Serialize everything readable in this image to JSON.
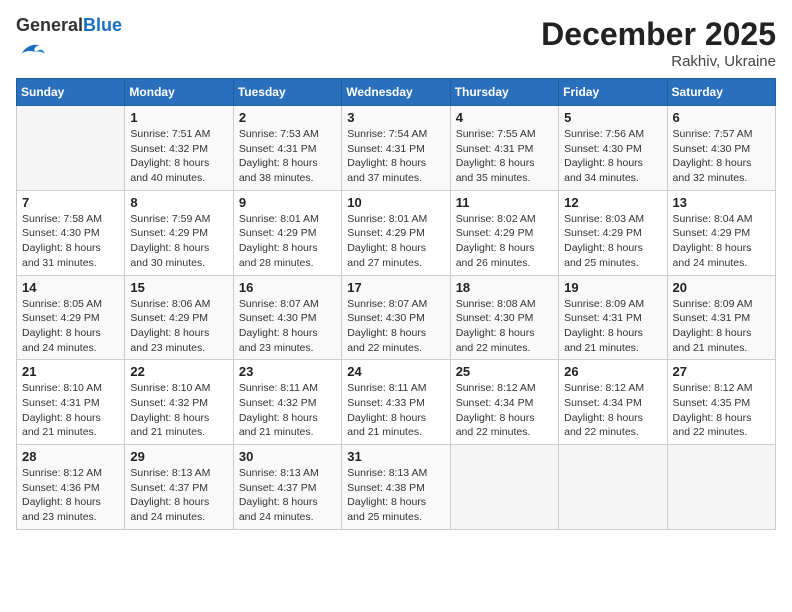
{
  "header": {
    "logo_general": "General",
    "logo_blue": "Blue",
    "month_title": "December 2025",
    "subtitle": "Rakhiv, Ukraine"
  },
  "weekdays": [
    "Sunday",
    "Monday",
    "Tuesday",
    "Wednesday",
    "Thursday",
    "Friday",
    "Saturday"
  ],
  "weeks": [
    [
      {
        "day": "",
        "info": ""
      },
      {
        "day": "1",
        "info": "Sunrise: 7:51 AM\nSunset: 4:32 PM\nDaylight: 8 hours\nand 40 minutes."
      },
      {
        "day": "2",
        "info": "Sunrise: 7:53 AM\nSunset: 4:31 PM\nDaylight: 8 hours\nand 38 minutes."
      },
      {
        "day": "3",
        "info": "Sunrise: 7:54 AM\nSunset: 4:31 PM\nDaylight: 8 hours\nand 37 minutes."
      },
      {
        "day": "4",
        "info": "Sunrise: 7:55 AM\nSunset: 4:31 PM\nDaylight: 8 hours\nand 35 minutes."
      },
      {
        "day": "5",
        "info": "Sunrise: 7:56 AM\nSunset: 4:30 PM\nDaylight: 8 hours\nand 34 minutes."
      },
      {
        "day": "6",
        "info": "Sunrise: 7:57 AM\nSunset: 4:30 PM\nDaylight: 8 hours\nand 32 minutes."
      }
    ],
    [
      {
        "day": "7",
        "info": "Sunrise: 7:58 AM\nSunset: 4:30 PM\nDaylight: 8 hours\nand 31 minutes."
      },
      {
        "day": "8",
        "info": "Sunrise: 7:59 AM\nSunset: 4:29 PM\nDaylight: 8 hours\nand 30 minutes."
      },
      {
        "day": "9",
        "info": "Sunrise: 8:01 AM\nSunset: 4:29 PM\nDaylight: 8 hours\nand 28 minutes."
      },
      {
        "day": "10",
        "info": "Sunrise: 8:01 AM\nSunset: 4:29 PM\nDaylight: 8 hours\nand 27 minutes."
      },
      {
        "day": "11",
        "info": "Sunrise: 8:02 AM\nSunset: 4:29 PM\nDaylight: 8 hours\nand 26 minutes."
      },
      {
        "day": "12",
        "info": "Sunrise: 8:03 AM\nSunset: 4:29 PM\nDaylight: 8 hours\nand 25 minutes."
      },
      {
        "day": "13",
        "info": "Sunrise: 8:04 AM\nSunset: 4:29 PM\nDaylight: 8 hours\nand 24 minutes."
      }
    ],
    [
      {
        "day": "14",
        "info": "Sunrise: 8:05 AM\nSunset: 4:29 PM\nDaylight: 8 hours\nand 24 minutes."
      },
      {
        "day": "15",
        "info": "Sunrise: 8:06 AM\nSunset: 4:29 PM\nDaylight: 8 hours\nand 23 minutes."
      },
      {
        "day": "16",
        "info": "Sunrise: 8:07 AM\nSunset: 4:30 PM\nDaylight: 8 hours\nand 23 minutes."
      },
      {
        "day": "17",
        "info": "Sunrise: 8:07 AM\nSunset: 4:30 PM\nDaylight: 8 hours\nand 22 minutes."
      },
      {
        "day": "18",
        "info": "Sunrise: 8:08 AM\nSunset: 4:30 PM\nDaylight: 8 hours\nand 22 minutes."
      },
      {
        "day": "19",
        "info": "Sunrise: 8:09 AM\nSunset: 4:31 PM\nDaylight: 8 hours\nand 21 minutes."
      },
      {
        "day": "20",
        "info": "Sunrise: 8:09 AM\nSunset: 4:31 PM\nDaylight: 8 hours\nand 21 minutes."
      }
    ],
    [
      {
        "day": "21",
        "info": "Sunrise: 8:10 AM\nSunset: 4:31 PM\nDaylight: 8 hours\nand 21 minutes."
      },
      {
        "day": "22",
        "info": "Sunrise: 8:10 AM\nSunset: 4:32 PM\nDaylight: 8 hours\nand 21 minutes."
      },
      {
        "day": "23",
        "info": "Sunrise: 8:11 AM\nSunset: 4:32 PM\nDaylight: 8 hours\nand 21 minutes."
      },
      {
        "day": "24",
        "info": "Sunrise: 8:11 AM\nSunset: 4:33 PM\nDaylight: 8 hours\nand 21 minutes."
      },
      {
        "day": "25",
        "info": "Sunrise: 8:12 AM\nSunset: 4:34 PM\nDaylight: 8 hours\nand 22 minutes."
      },
      {
        "day": "26",
        "info": "Sunrise: 8:12 AM\nSunset: 4:34 PM\nDaylight: 8 hours\nand 22 minutes."
      },
      {
        "day": "27",
        "info": "Sunrise: 8:12 AM\nSunset: 4:35 PM\nDaylight: 8 hours\nand 22 minutes."
      }
    ],
    [
      {
        "day": "28",
        "info": "Sunrise: 8:12 AM\nSunset: 4:36 PM\nDaylight: 8 hours\nand 23 minutes."
      },
      {
        "day": "29",
        "info": "Sunrise: 8:13 AM\nSunset: 4:37 PM\nDaylight: 8 hours\nand 24 minutes."
      },
      {
        "day": "30",
        "info": "Sunrise: 8:13 AM\nSunset: 4:37 PM\nDaylight: 8 hours\nand 24 minutes."
      },
      {
        "day": "31",
        "info": "Sunrise: 8:13 AM\nSunset: 4:38 PM\nDaylight: 8 hours\nand 25 minutes."
      },
      {
        "day": "",
        "info": ""
      },
      {
        "day": "",
        "info": ""
      },
      {
        "day": "",
        "info": ""
      }
    ]
  ]
}
